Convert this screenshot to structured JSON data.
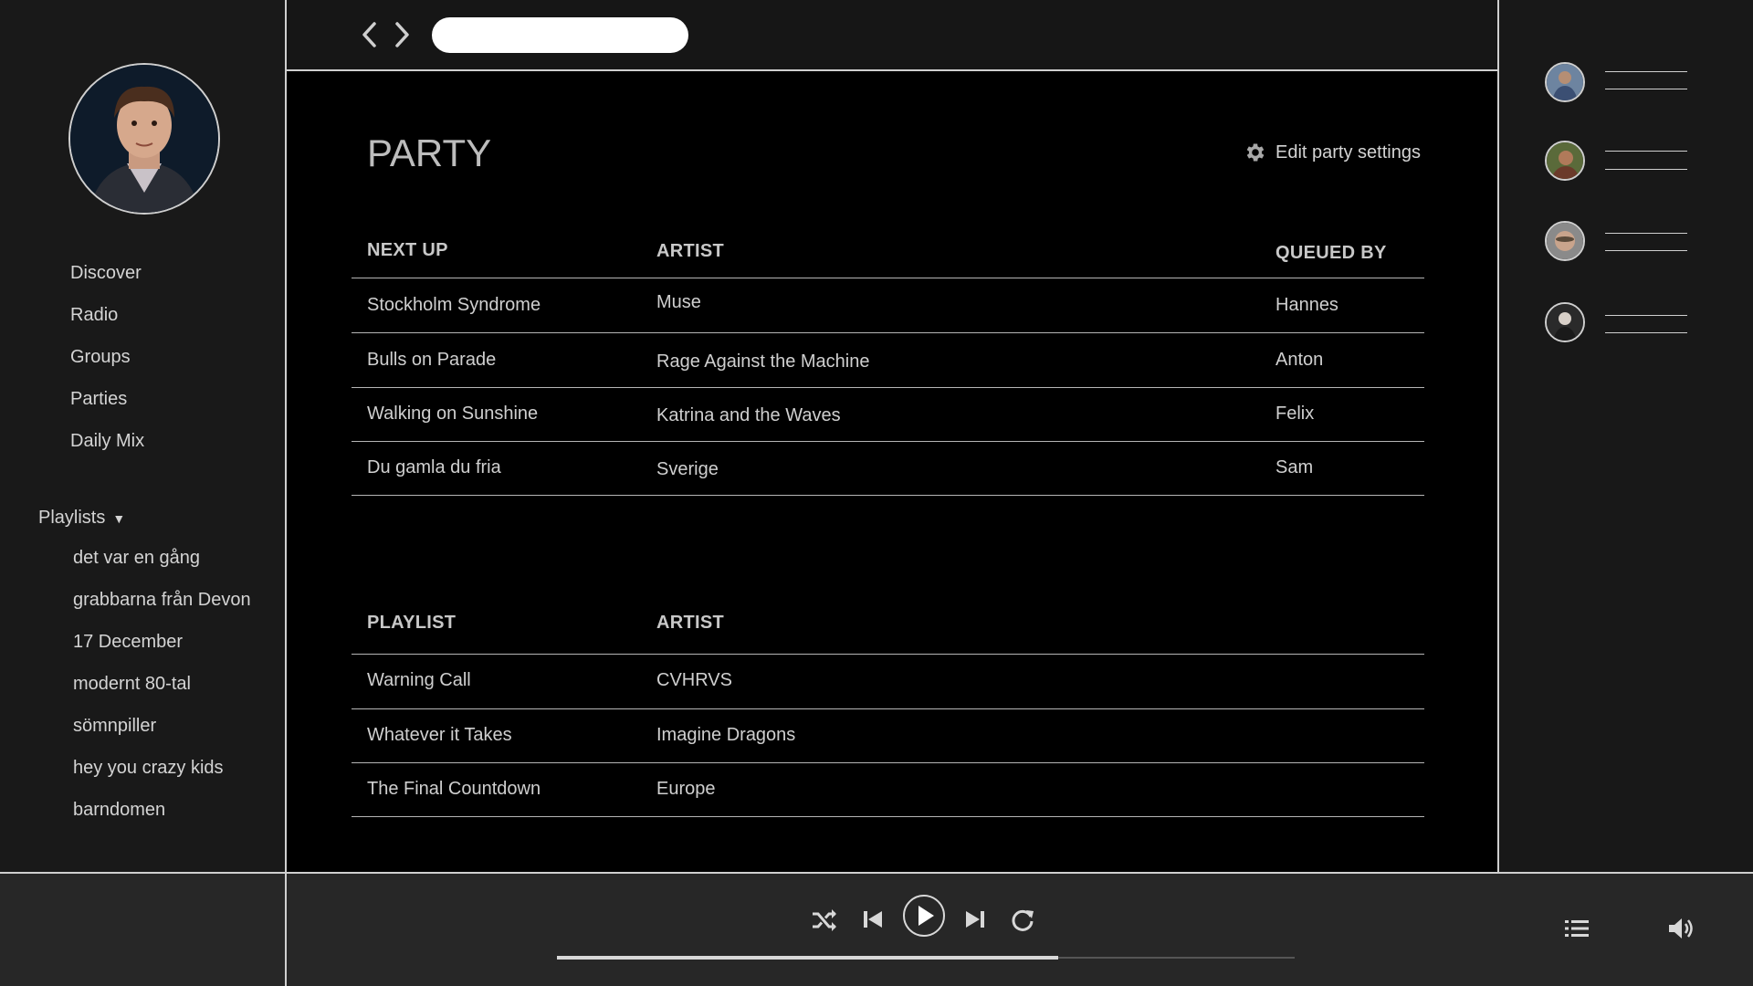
{
  "sidebar": {
    "nav": [
      "Discover",
      "Radio",
      "Groups",
      "Parties",
      "Daily Mix"
    ],
    "playlists_label": "Playlists",
    "playlists": [
      "det var en gång",
      "grabbarna från Devon",
      "17 December",
      "modernt 80-tal",
      "sömnpiller",
      "hey you crazy kids",
      "barndomen"
    ]
  },
  "topbar": {
    "search_value": ""
  },
  "main": {
    "title": "PARTY",
    "settings_label": "Edit party settings",
    "queue": {
      "headers": [
        "NEXT UP",
        "ARTIST",
        "QUEUED BY"
      ],
      "rows": [
        [
          "Stockholm Syndrome",
          "Muse",
          "Hannes"
        ],
        [
          "Bulls on Parade",
          "Rage Against the Machine",
          "Anton"
        ],
        [
          "Walking on Sunshine",
          "Katrina and the Waves",
          "Felix"
        ],
        [
          "Du gamla du fria",
          "Sverige",
          "Sam"
        ]
      ]
    },
    "playlist": {
      "headers": [
        "PLAYLIST",
        "ARTIST"
      ],
      "rows": [
        [
          "Warning Call",
          "CVHRVS"
        ],
        [
          "Whatever it Takes",
          "Imagine Dragons"
        ],
        [
          "The Final Countdown",
          "Europe"
        ]
      ]
    }
  },
  "friends_count": 4,
  "player": {
    "progress": 0.68
  },
  "colors": {
    "background": "#161616",
    "main": "#000000",
    "text": "#cfcfcf",
    "player": "#272727"
  }
}
